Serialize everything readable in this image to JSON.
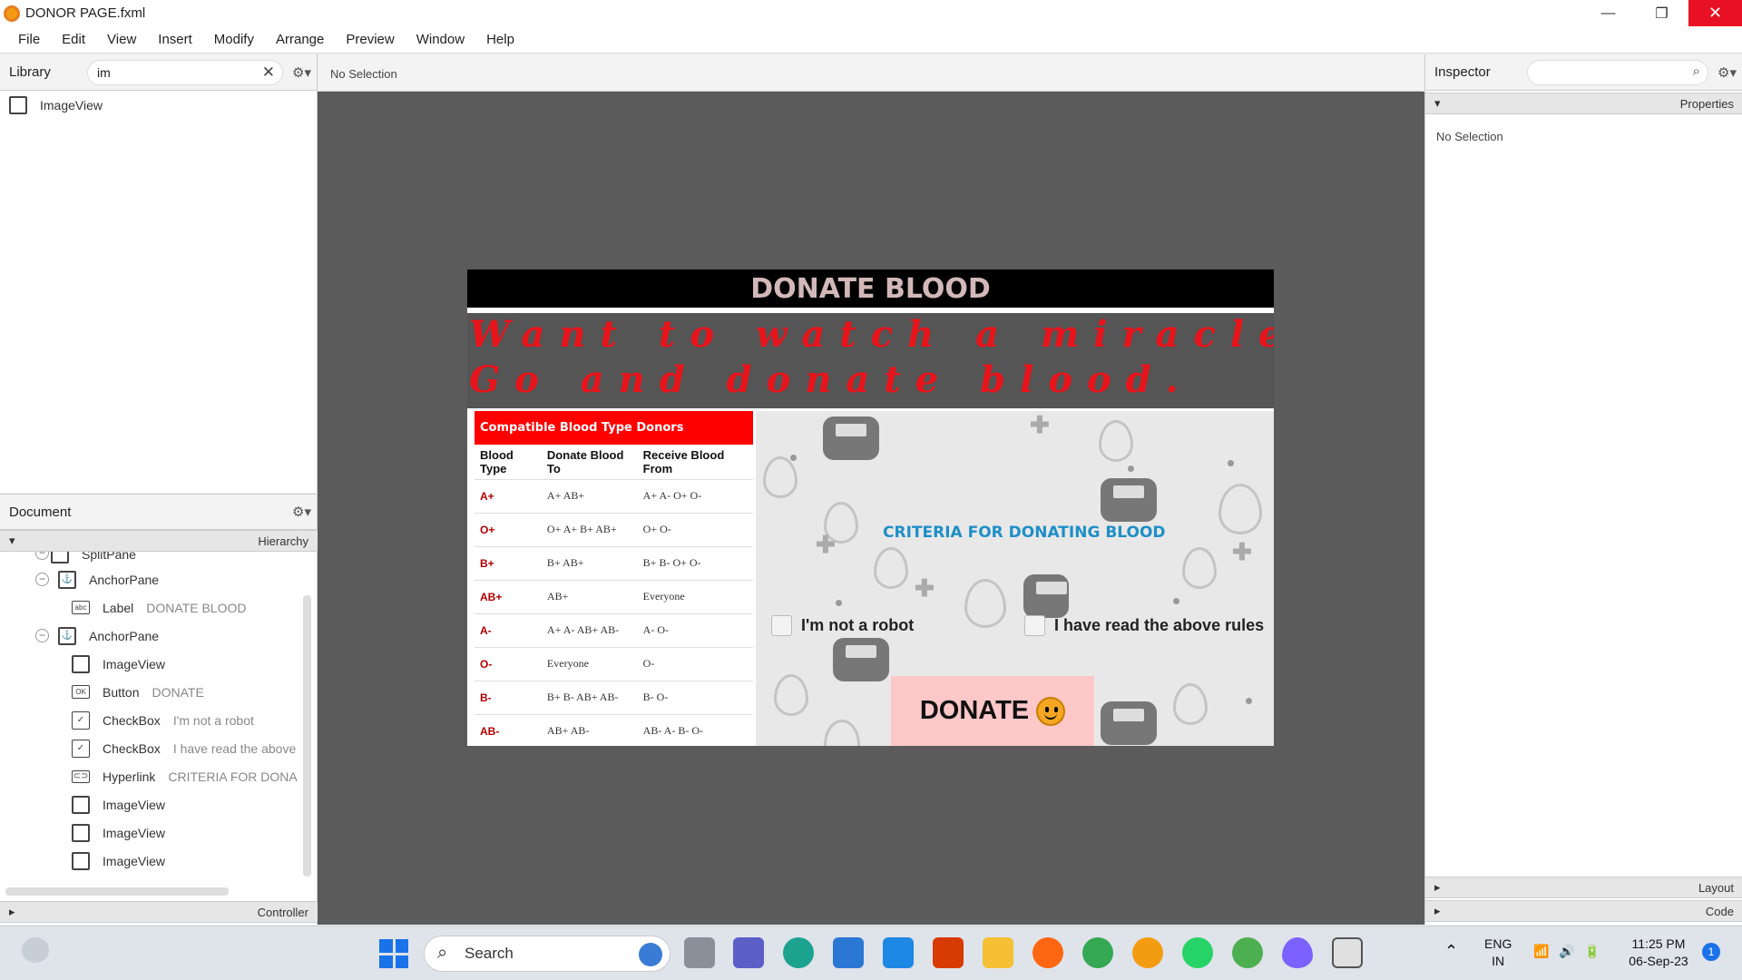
{
  "window": {
    "title": "DONOR PAGE.fxml",
    "minimize": "—",
    "maximize": "❐",
    "close": "✕"
  },
  "menu": [
    "File",
    "Edit",
    "View",
    "Insert",
    "Modify",
    "Arrange",
    "Preview",
    "Window",
    "Help"
  ],
  "library": {
    "title": "Library",
    "search_value": "im",
    "results": [
      {
        "label": "ImageView",
        "icon": "imageview-icon"
      }
    ]
  },
  "document": {
    "title": "Document",
    "hierarchy_label": "Hierarchy",
    "controller_label": "Controller",
    "tree": [
      {
        "label": "SplitPane",
        "value": "",
        "icon": "splitpane-icon"
      },
      {
        "label": "AnchorPane",
        "value": "",
        "icon": "anchorpane-icon"
      },
      {
        "label": "Label",
        "value": "DONATE BLOOD",
        "icon": "label-icon"
      },
      {
        "label": "AnchorPane",
        "value": "",
        "icon": "anchorpane-icon"
      },
      {
        "label": "ImageView",
        "value": "",
        "icon": "imageview-icon"
      },
      {
        "label": "Button",
        "value": "DONATE",
        "icon": "button-icon"
      },
      {
        "label": "CheckBox",
        "value": "I'm not a robot",
        "icon": "checkbox-icon"
      },
      {
        "label": "CheckBox",
        "value": "I have read the above",
        "icon": "checkbox-icon"
      },
      {
        "label": "Hyperlink",
        "value": "CRITERIA FOR DONA",
        "icon": "hyperlink-icon"
      },
      {
        "label": "ImageView",
        "value": "",
        "icon": "imageview-icon"
      },
      {
        "label": "ImageView",
        "value": "",
        "icon": "imageview-icon"
      },
      {
        "label": "ImageView",
        "value": "",
        "icon": "imageview-icon"
      }
    ]
  },
  "content": {
    "selection_label": "No Selection"
  },
  "inspector": {
    "title": "Inspector",
    "properties_label": "Properties",
    "no_selection": "No Selection",
    "layout_label": "Layout",
    "code_label": "Code"
  },
  "design": {
    "title": "DONATE BLOOD",
    "banner_line1": "Want to watch a miracle?",
    "banner_line2": "Go and donate blood.",
    "table_title": "Compatible Blood Type Donors",
    "headers": [
      "Blood Type",
      "Donate Blood To",
      "Receive Blood From"
    ],
    "rows": [
      [
        "A+",
        "A+ AB+",
        "A+ A- O+ O-"
      ],
      [
        "O+",
        "O+ A+ B+ AB+",
        "O+ O-"
      ],
      [
        "B+",
        "B+ AB+",
        "B+ B- O+ O-"
      ],
      [
        "AB+",
        "AB+",
        "Everyone"
      ],
      [
        "A-",
        "A+ A- AB+ AB-",
        "A- O-"
      ],
      [
        "O-",
        "Everyone",
        "O-"
      ],
      [
        "B-",
        "B+ B- AB+ AB-",
        "B- O-"
      ],
      [
        "AB-",
        "AB+ AB-",
        "AB- A- B- O-"
      ]
    ],
    "criteria_link": "CRITERIA FOR DONATING BLOOD",
    "checkbox1": "I'm not a robot",
    "checkbox2": "I have read the above rules",
    "button": "DONATE"
  },
  "taskbar": {
    "search_placeholder": "Search",
    "lang1": "ENG",
    "lang2": "IN",
    "time": "11:25 PM",
    "date": "06-Sep-23",
    "notif_count": "1"
  },
  "colors": {
    "title_bg": "#000000",
    "table_header": "#ff0000",
    "banner_text": "#e8141b",
    "criteria": "#1e8fc7",
    "donate_bg": "#ffc8c8"
  }
}
